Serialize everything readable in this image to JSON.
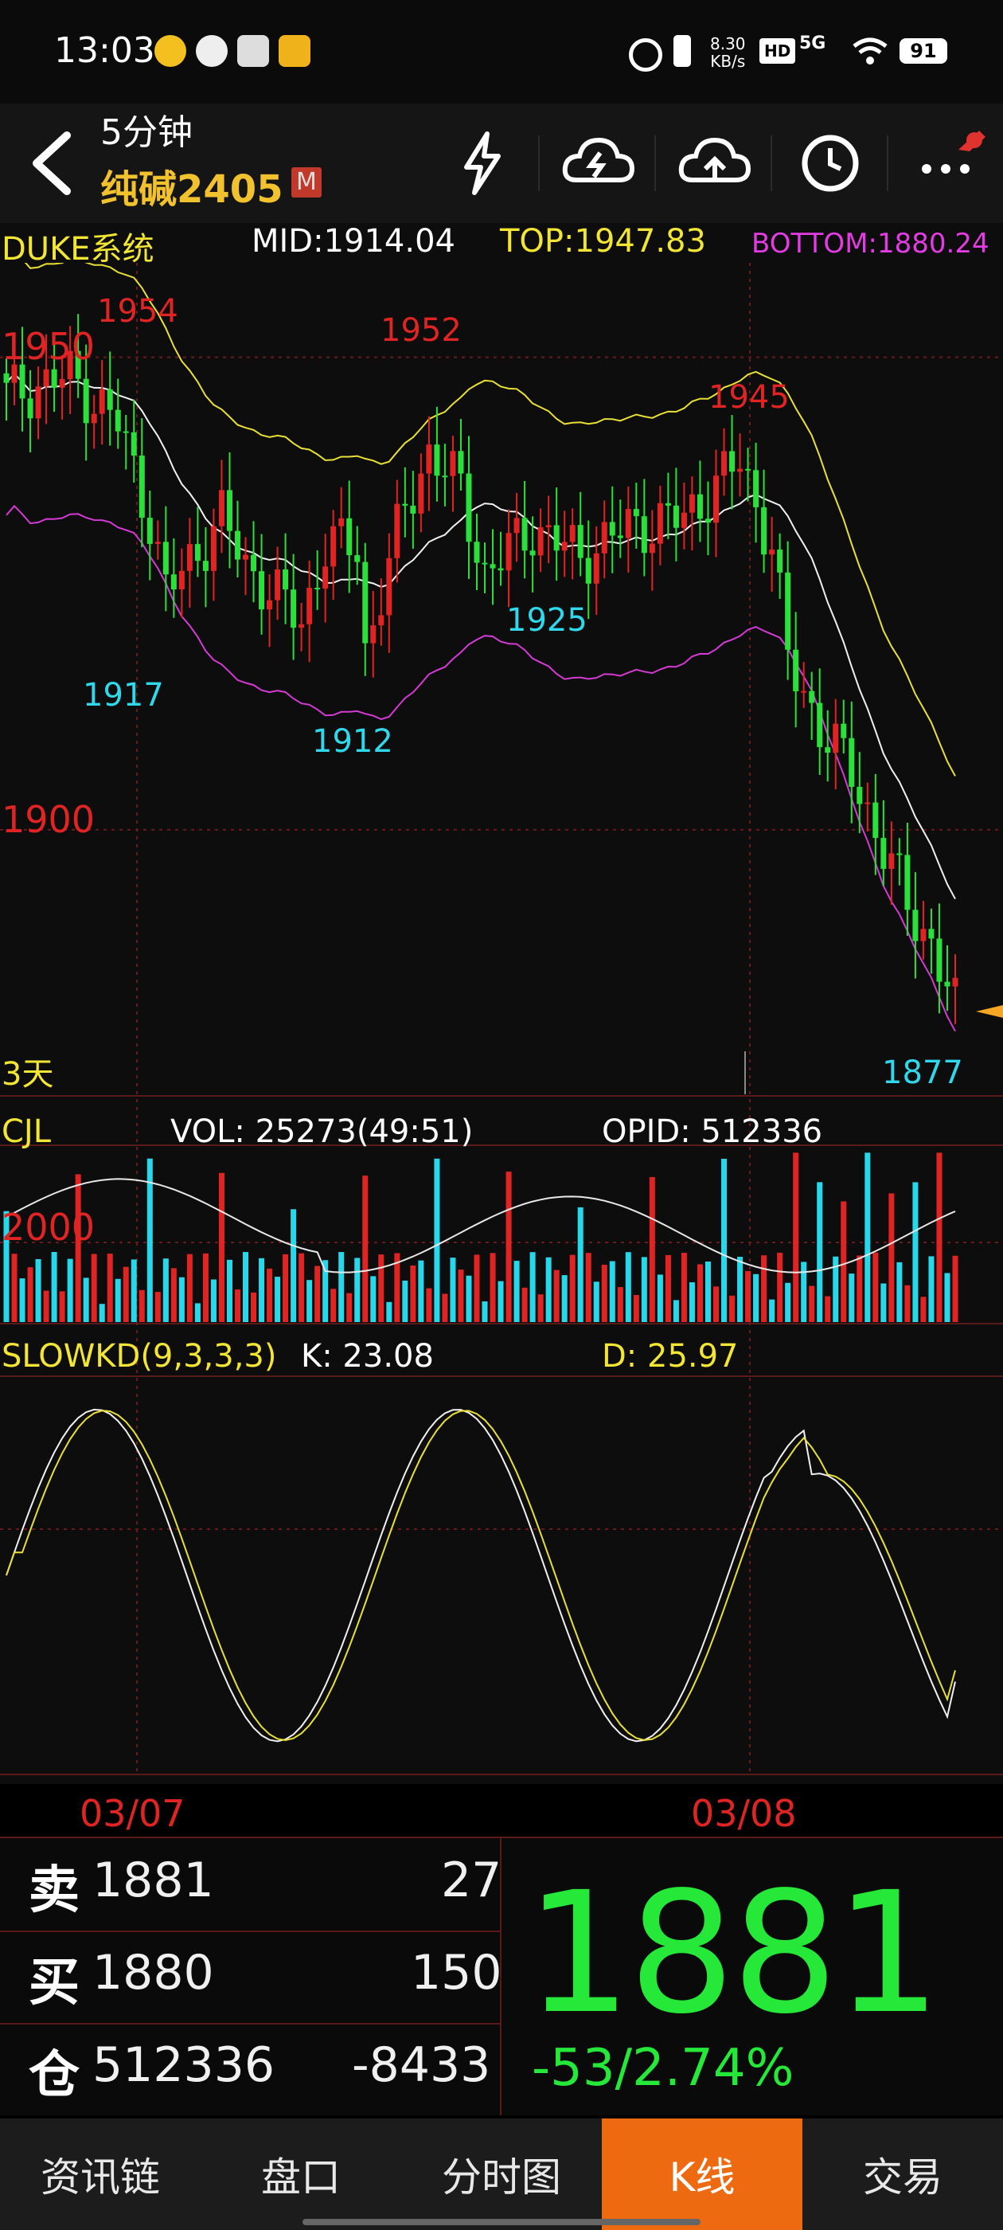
{
  "status_bar": {
    "time": "13:03",
    "net_speed_top": "8.30",
    "net_speed_bottom": "KB/s",
    "hd": "HD",
    "signal": "5G",
    "battery": "91"
  },
  "header": {
    "title": "5分钟",
    "subtitle": "纯碱2405",
    "badge": "M"
  },
  "indicator_bar": {
    "name": "DUKE系统",
    "mid": "MID:1914.04",
    "top": "TOP:1947.83",
    "bottom": "BOTTOM:1880.24",
    "colors": {
      "name": "#f2e534",
      "mid": "#ffffff",
      "top": "#f2e534",
      "bottom": "#e23ce2"
    }
  },
  "price_panel": {
    "y_labels": [
      "1950",
      "1900"
    ],
    "peak_labels": [
      "1954",
      "1952",
      "1945"
    ],
    "trough_labels": [
      "1917",
      "1912",
      "1925",
      "1877"
    ],
    "period": "3天"
  },
  "volume_panel": {
    "name": "CJL",
    "vol": "VOL: 25273(49:51)",
    "opid": "OPID: 512336",
    "y_label": "2000"
  },
  "kd_panel": {
    "name": "SLOWKD(9,3,3,3)",
    "k": "K: 23.08",
    "d": "D: 25.97"
  },
  "date_axis": [
    "03/07",
    "03/08"
  ],
  "quote": {
    "sell_label": "卖",
    "sell_price": "1881",
    "sell_qty": "27",
    "buy_label": "买",
    "buy_price": "1880",
    "buy_qty": "150",
    "oi_label": "仓",
    "oi_value": "512336",
    "oi_change": "-8433",
    "last_price": "1881",
    "change": "-53/2.74%"
  },
  "tabs": [
    "资讯链",
    "盘口",
    "分时图",
    "K线",
    "交易"
  ],
  "active_tab": "K线",
  "chart_data": [
    {
      "type": "candlestick",
      "title": "纯碱2405 5分钟",
      "ylim": [
        1872,
        1960
      ],
      "levels": {
        "mid": 1914.04,
        "top": 1947.83,
        "bottom": 1880.24
      },
      "x": [
        "03/07",
        "03/08"
      ],
      "marked_highs": [
        1954,
        1952,
        1945
      ],
      "marked_lows": [
        1917,
        1912,
        1925,
        1877
      ]
    },
    {
      "type": "bar",
      "title": "CJL",
      "ylim": [
        0,
        3000
      ],
      "notes": "volume bars"
    },
    {
      "type": "line",
      "title": "SLOWKD(9,3,3,3)",
      "series": [
        {
          "name": "K",
          "last": 23.08
        },
        {
          "name": "D",
          "last": 25.97
        }
      ]
    }
  ]
}
